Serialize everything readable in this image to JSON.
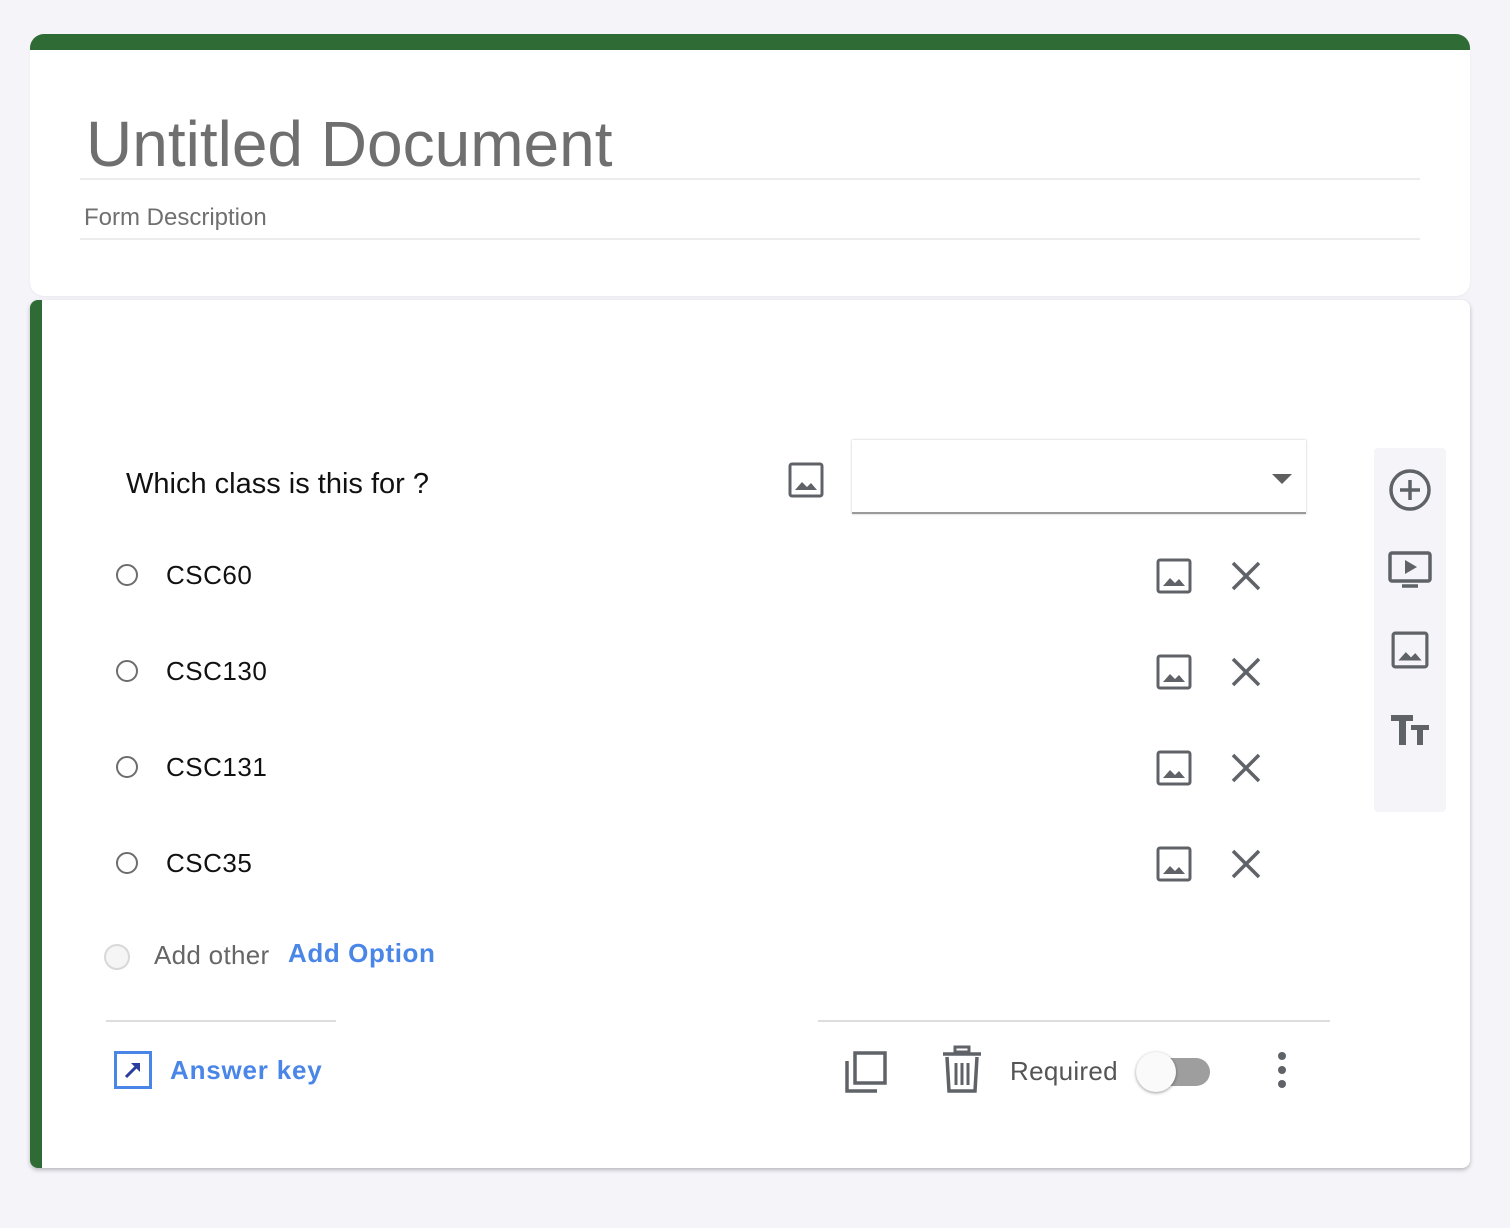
{
  "theme": {
    "accent": "#2f6b34",
    "link": "#4a86e8",
    "icon": "#5f6368"
  },
  "header": {
    "title": "Untitled Document",
    "description": "Form Description"
  },
  "question": {
    "text": "Which class is this for ?",
    "type_value": "",
    "options": [
      {
        "label": "CSC60"
      },
      {
        "label": "CSC130"
      },
      {
        "label": "CSC131"
      },
      {
        "label": "CSC35"
      }
    ],
    "add_other_label": "Add other",
    "add_option_label": "Add Option",
    "answer_key_label": "Answer key",
    "required_label": "Required",
    "required_on": false
  },
  "side_toolbar": {
    "icons": [
      "add-circle-icon",
      "video-icon",
      "image-icon",
      "text-format-icon"
    ]
  }
}
